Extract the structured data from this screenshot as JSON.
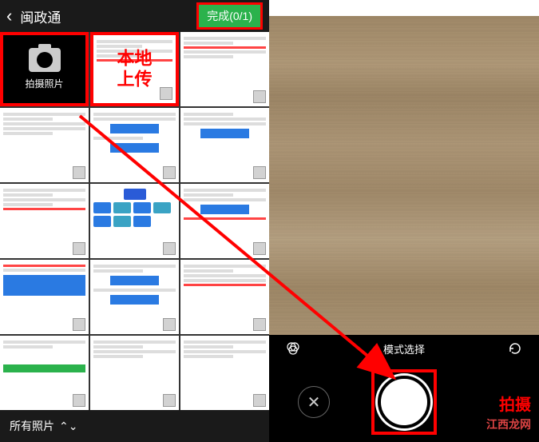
{
  "header": {
    "title": "闽政通",
    "done_label": "完成(0/1)"
  },
  "camera_cell_label": "拍摄照片",
  "local_upload_label": "本地\n上传",
  "all_photos_label": "所有照片",
  "mode_bar": {
    "label": "模式选择"
  },
  "shoot_label": "拍摄",
  "watermark": "江西龙网",
  "colors": {
    "accent_red": "#ff0000",
    "accent_green": "#2bb24c",
    "accent_blue": "#2a7ae2"
  }
}
